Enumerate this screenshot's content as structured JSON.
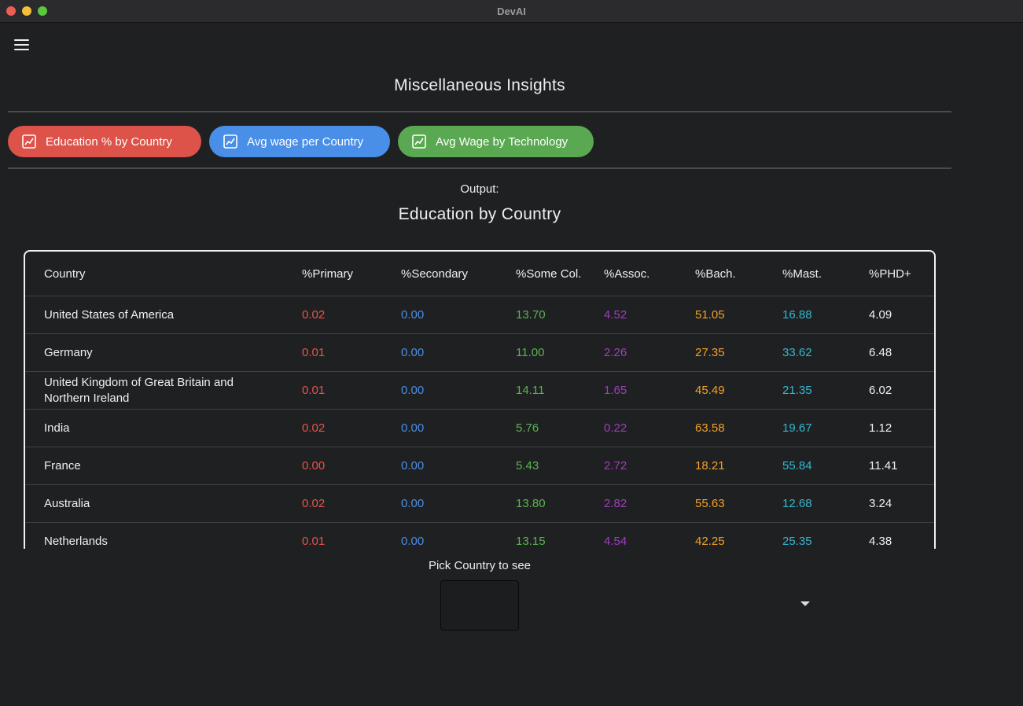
{
  "window": {
    "title": "DevAI"
  },
  "icons": {
    "menu": "menu-icon",
    "chart": "chart-icon",
    "dropdown": "chevron-down-icon"
  },
  "page": {
    "title": "Miscellaneous Insights"
  },
  "buttons": [
    {
      "label": "Education % by Country",
      "color": "#dd5249"
    },
    {
      "label": "Avg wage per Country",
      "color": "#4a8fe7"
    },
    {
      "label": "Avg Wage by Technology",
      "color": "#5aa852"
    }
  ],
  "output": {
    "label": "Output:",
    "title": "Education by Country"
  },
  "table": {
    "columns": [
      "Country",
      "%Primary",
      "%Secondary",
      "%Some Col.",
      "%Assoc.",
      "%Bach.",
      "%Mast.",
      "%PHD+"
    ],
    "column_colors": [
      "#f0f0f0",
      "#e8544a",
      "#4a8fe7",
      "#5cb352",
      "#a23cbf",
      "#f1a128",
      "#33b8d0",
      "#f0f0f0"
    ],
    "rows": [
      [
        "United States of America",
        "0.02",
        "0.00",
        "13.70",
        "4.52",
        "51.05",
        "16.88",
        "4.09"
      ],
      [
        "Germany",
        "0.01",
        "0.00",
        "11.00",
        "2.26",
        "27.35",
        "33.62",
        "6.48"
      ],
      [
        "United Kingdom of Great Britain and Northern Ireland",
        "0.01",
        "0.00",
        "14.11",
        "1.65",
        "45.49",
        "21.35",
        "6.02"
      ],
      [
        "India",
        "0.02",
        "0.00",
        "5.76",
        "0.22",
        "63.58",
        "19.67",
        "1.12"
      ],
      [
        "France",
        "0.00",
        "0.00",
        "5.43",
        "2.72",
        "18.21",
        "55.84",
        "11.41"
      ],
      [
        "Australia",
        "0.02",
        "0.00",
        "13.80",
        "2.82",
        "55.63",
        "12.68",
        "3.24"
      ],
      [
        "Netherlands",
        "0.01",
        "0.00",
        "13.15",
        "4.54",
        "42.25",
        "25.35",
        "4.38"
      ]
    ]
  },
  "picker": {
    "label": "Pick Country to see",
    "value": ""
  }
}
